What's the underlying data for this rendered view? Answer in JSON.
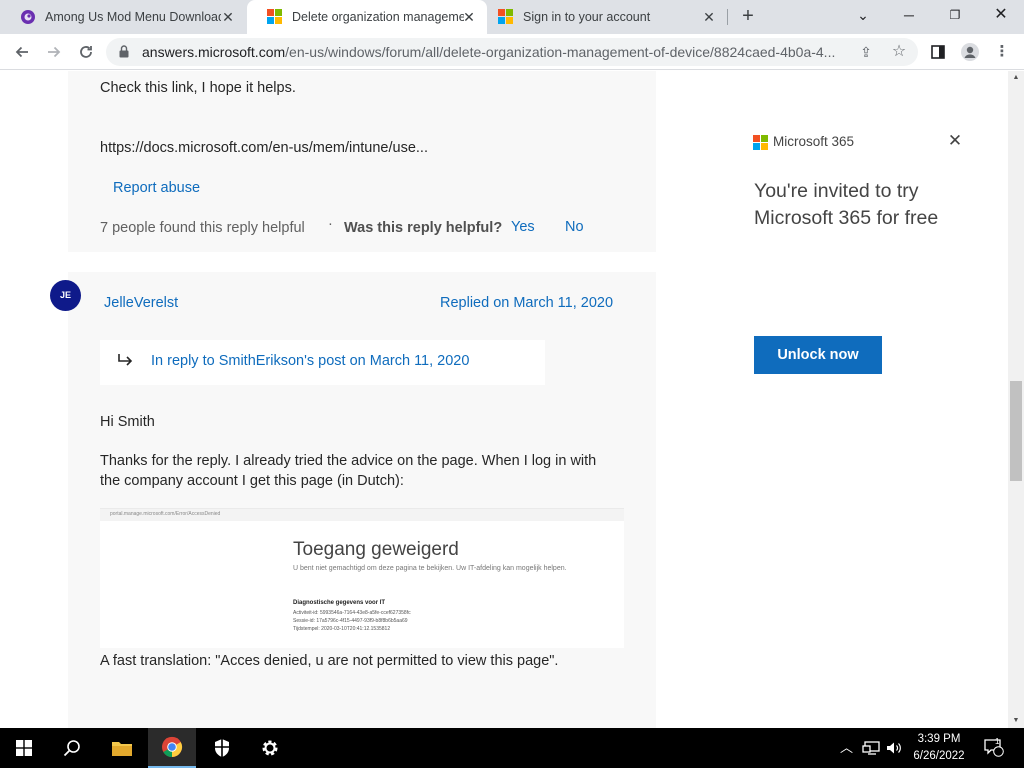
{
  "browser": {
    "tabs": [
      {
        "title": "Among Us Mod Menu Download",
        "favicon": "among-us-favicon",
        "active": false
      },
      {
        "title": "Delete organization management",
        "favicon": "microsoft-logo",
        "active": true
      },
      {
        "title": "Sign in to your account",
        "favicon": "microsoft-logo",
        "active": false
      }
    ],
    "url_domain": "answers.microsoft.com",
    "url_path": "/en-us/windows/forum/all/delete-organization-management-of-device/8824caed-4b0a-4..."
  },
  "post_prev": {
    "text": "Check this link, I hope it helps.",
    "link": "https://docs.microsoft.com/en-us/mem/intune/use...",
    "report_abuse": "Report abuse",
    "helpful_count": "7 people found this reply helpful",
    "separator": "·",
    "question": "Was this reply helpful?",
    "yes": "Yes",
    "no": "No"
  },
  "post": {
    "avatar_initials": "JE",
    "author": "JelleVerelst",
    "replied_on": "Replied on March 11, 2020",
    "in_reply_to": "In reply to SmithErikson's post on March 11, 2020",
    "greeting": "Hi Smith",
    "body_line1": "Thanks for the reply. I already tried the advice on the page. When I log in with",
    "body_line2": "the company account I get this page (in Dutch):",
    "embedded": {
      "url": "portal.manage.microsoft.com/Error/AccessDenied",
      "title": "Toegang geweigerd",
      "message": "U bent niet gemachtigd om deze pagina te bekijken. Uw IT-afdeling kan mogelijk helpen.",
      "diag_title": "Diagnostische gegevens voor IT",
      "lines": [
        "Activiteit-id: 5993546a-7164-43e8-a5fe-ccef627358fc",
        "Sessie-id: 17a5796c-4f15-4497-93f9-b8f8b6b5aa69",
        "Tijdstempel: 2020-03-10T20:41:12.1535812"
      ]
    },
    "translation": "A fast translation: \"Acces denied, u are not permitted to view this page\"."
  },
  "ad": {
    "brand": "Microsoft 365",
    "headline_line1": "You're invited to try",
    "headline_line2": "Microsoft 365 for free",
    "cta": "Unlock now"
  },
  "taskbar": {
    "time": "3:39 PM",
    "date": "6/26/2022",
    "notification_count": "1"
  },
  "colors": {
    "accent": "#0f6cbd",
    "avatar": "#0f1a8a",
    "card_bg": "#f8f8f8"
  }
}
